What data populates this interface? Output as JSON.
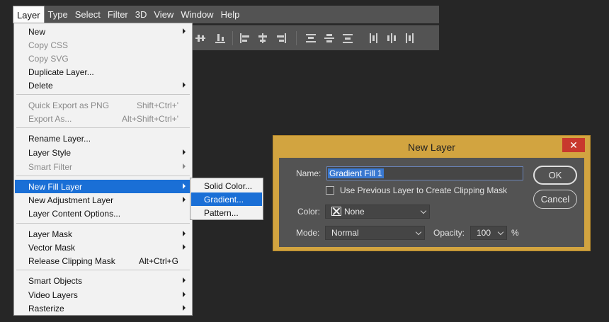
{
  "menubar": [
    "Layer",
    "Type",
    "Select",
    "Filter",
    "3D",
    "View",
    "Window",
    "Help"
  ],
  "layer_menu": {
    "items": [
      {
        "label": "New",
        "submenu": true
      },
      {
        "label": "Copy CSS",
        "disabled": true
      },
      {
        "label": "Copy SVG",
        "disabled": true
      },
      {
        "label": "Duplicate Layer..."
      },
      {
        "label": "Delete",
        "submenu": true
      },
      {
        "label": "Quick Export as PNG",
        "shortcut": "Shift+Ctrl+'",
        "disabled": true
      },
      {
        "label": "Export As...",
        "shortcut": "Alt+Shift+Ctrl+'",
        "disabled": true
      },
      {
        "label": "Rename Layer..."
      },
      {
        "label": "Layer Style",
        "submenu": true
      },
      {
        "label": "Smart Filter",
        "submenu": true,
        "disabled": true
      },
      {
        "label": "New Fill Layer",
        "submenu": true,
        "highlighted": true
      },
      {
        "label": "New Adjustment Layer",
        "submenu": true
      },
      {
        "label": "Layer Content Options..."
      },
      {
        "label": "Layer Mask",
        "submenu": true
      },
      {
        "label": "Vector Mask",
        "submenu": true
      },
      {
        "label": "Release Clipping Mask",
        "shortcut": "Alt+Ctrl+G"
      },
      {
        "label": "Smart Objects",
        "submenu": true
      },
      {
        "label": "Video Layers",
        "submenu": true
      },
      {
        "label": "Rasterize",
        "submenu": true
      }
    ]
  },
  "fill_submenu": {
    "items": [
      {
        "label": "Solid Color..."
      },
      {
        "label": "Gradient...",
        "highlighted": true
      },
      {
        "label": "Pattern..."
      }
    ]
  },
  "dialog": {
    "title": "New Layer",
    "close_glyph": "✕",
    "name_label": "Name:",
    "name_value": "Gradient Fill 1",
    "clipping_label": "Use Previous Layer to Create Clipping Mask",
    "color_label": "Color:",
    "color_value": "None",
    "mode_label": "Mode:",
    "mode_value": "Normal",
    "opacity_label": "Opacity:",
    "opacity_value": "100",
    "opacity_unit": "%",
    "ok_label": "OK",
    "cancel_label": "Cancel"
  },
  "colors": {
    "highlight": "#1a6fd6",
    "dialog_frame": "#d2a440",
    "close_button": "#c8382d"
  }
}
